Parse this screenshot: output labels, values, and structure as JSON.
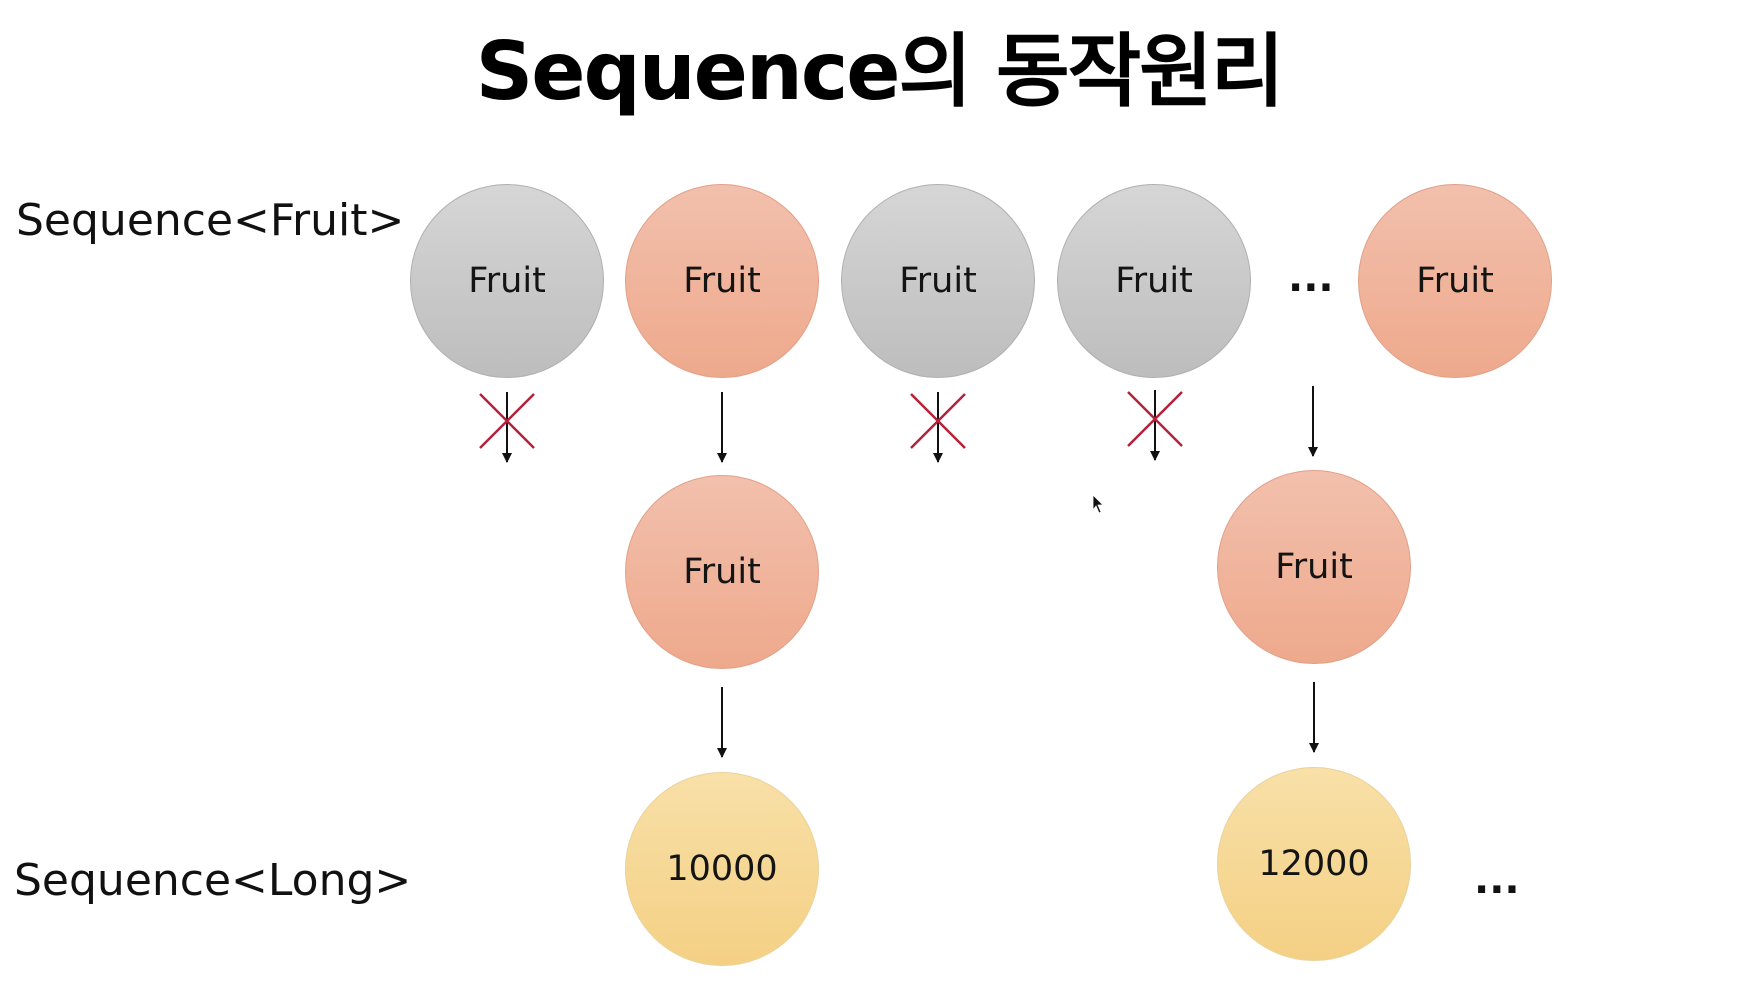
{
  "title": "Sequence의 동작원리",
  "labels": {
    "fruit_sequence": "Sequence<Fruit>",
    "long_sequence": "Sequence<Long>"
  },
  "source_row": {
    "nodes": [
      {
        "label": "Fruit",
        "color": "#c9c9c9",
        "passes_filter": false
      },
      {
        "label": "Fruit",
        "color": "#f0b59c",
        "passes_filter": true
      },
      {
        "label": "Fruit",
        "color": "#c9c9c9",
        "passes_filter": false
      },
      {
        "label": "Fruit",
        "color": "#c9c9c9",
        "passes_filter": false
      },
      {
        "label": "Fruit",
        "color": "#f0b59c",
        "passes_filter": true
      }
    ],
    "ellipsis": "..."
  },
  "filtered_row": {
    "nodes": [
      {
        "label": "Fruit",
        "color": "#f0b59c"
      },
      {
        "label": "Fruit",
        "color": "#f0b59c"
      }
    ]
  },
  "result_row": {
    "nodes": [
      {
        "label": "10000",
        "color": "#f6d995"
      },
      {
        "label": "12000",
        "color": "#f6d995"
      }
    ],
    "ellipsis": "..."
  },
  "colors": {
    "arrow": "#111111",
    "reject_mark": "#b3223a",
    "kept_fruit": "#f0b59c",
    "rejected_fruit": "#c9c9c9",
    "mapped_value": "#f6d995"
  },
  "icons": {
    "reject": "x-mark-icon",
    "flow": "down-arrow-icon",
    "cursor": "mouse-pointer-icon"
  }
}
